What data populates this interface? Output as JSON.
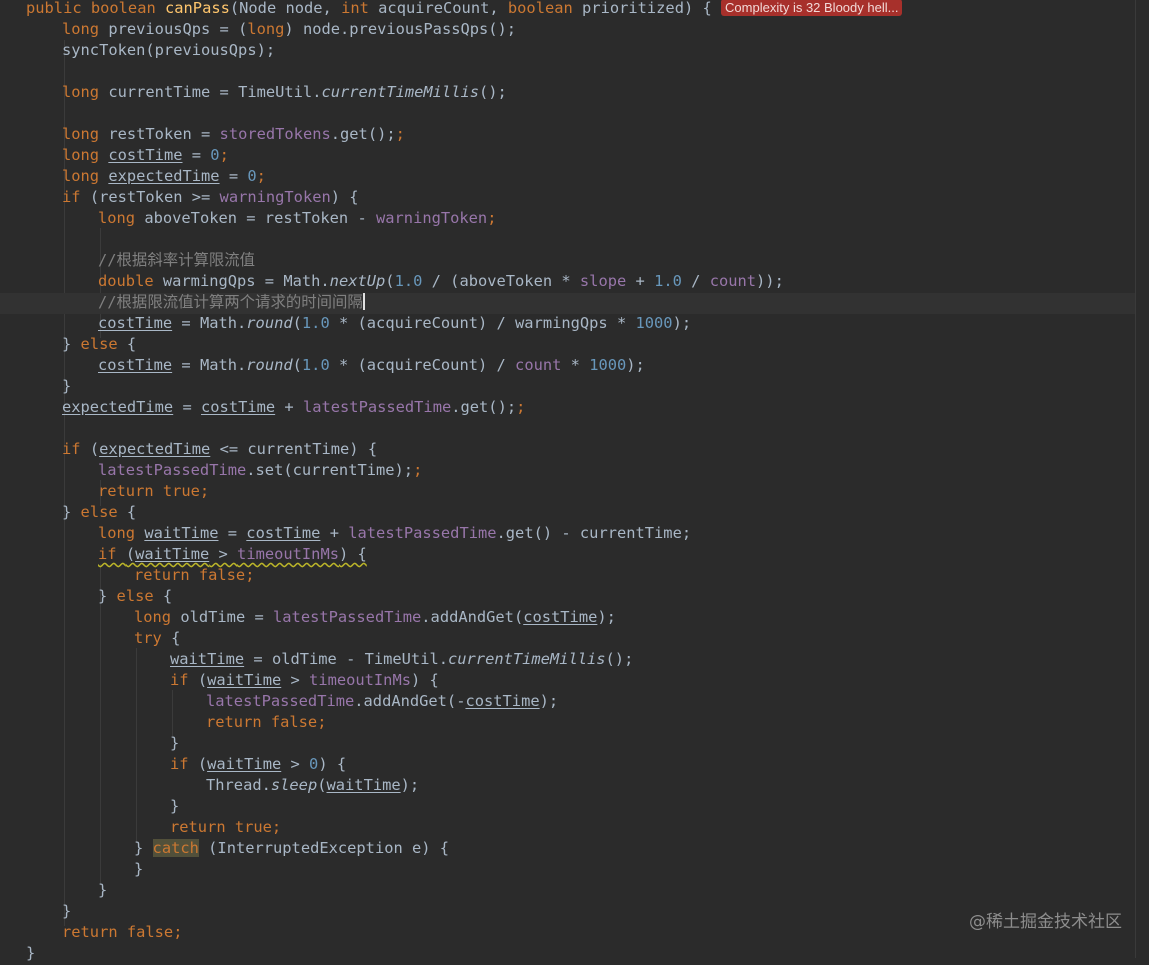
{
  "editor": {
    "complexity_hint": "Complexity is 32 Bloody hell...",
    "colors": {
      "background": "#2b2b2b",
      "keyword": "#cc7832",
      "method": "#ffc66d",
      "field": "#9876aa",
      "number": "#6897bb",
      "comment": "#808080",
      "text": "#a9b7c6",
      "badge": "#a7302b"
    },
    "code": {
      "l1": {
        "a": "public boolean ",
        "b": "canPass",
        "c": "(Node node, ",
        "d": "int ",
        "e": "acquireCount, ",
        "f": "boolean ",
        "g": "prioritized) { "
      },
      "l2": {
        "a": "long ",
        "b": "previousQps = (",
        "c": "long",
        "d": ") node.previousPassQps();"
      },
      "l3": {
        "a": "syncToken(previousQps);"
      },
      "l5": {
        "a": "long ",
        "b": "currentTime = TimeUtil.",
        "c": "currentTimeMillis",
        "d": "();"
      },
      "l7": {
        "a": "long ",
        "b": "restToken = ",
        "c": "storedTokens",
        "d": ".get();"
      },
      "l8": {
        "a": "long ",
        "b": "costTime",
        "c": " = ",
        "d": "0",
        ";": ";"
      },
      "l9": {
        "a": "long ",
        "b": "expectedTime",
        "c": " = ",
        "d": "0",
        ";": ";"
      },
      "l10": {
        "a": "if ",
        "b": "(restToken >= ",
        "c": "warningToken",
        "d": ") {"
      },
      "l11": {
        "a": "long ",
        "b": "aboveToken = restToken - ",
        "c": "warningToken",
        ";": ";"
      },
      "l13": {
        "a": "//根据斜率计算限流值"
      },
      "l14": {
        "a": "double ",
        "b": "warmingQps = Math.",
        "c": "nextUp",
        "d": "(",
        "n1": "1.0",
        "e": " / (aboveToken * ",
        "f": "slope",
        "g": " + ",
        "n2": "1.0",
        "h": " / ",
        "i": "count",
        "j": "));"
      },
      "l15": {
        "a": "//根据限流值计算两个请求的时间间隔"
      },
      "l16": {
        "a": "costTime",
        "b": " = Math.",
        "c": "round",
        "d": "(",
        "n1": "1.0",
        "e": " * (acquireCount) / warmingQps * ",
        "n2": "1000",
        "f": ");"
      },
      "l17": {
        "a": "} ",
        "b": "else ",
        "c": "{"
      },
      "l18": {
        "a": "costTime",
        "b": " = Math.",
        "c": "round",
        "d": "(",
        "n1": "1.0",
        "e": " * (acquireCount) / ",
        "f": "count",
        "g": " * ",
        "n2": "1000",
        "h": ");"
      },
      "l19": {
        "a": "}"
      },
      "l20": {
        "a": "expectedTime",
        "b": " = ",
        "c": "costTime",
        "d": " + ",
        "e": "latestPassedTime",
        "f": ".get();"
      },
      "l22": {
        "a": "if ",
        "b": "(",
        "c": "expectedTime",
        "d": " <= currentTime) {"
      },
      "l23": {
        "a": "latestPassedTime",
        "b": ".set(currentTime);"
      },
      "l24": {
        "a": "return true;"
      },
      "l25": {
        "a": "} ",
        "b": "else ",
        "c": "{"
      },
      "l26": {
        "a": "long ",
        "b": "waitTime",
        "c": " = ",
        "d": "costTime",
        "e": " + ",
        "f": "latestPassedTime",
        "g": ".get() - currentTime;"
      },
      "l27": {
        "a": "if ",
        "b": "(",
        "c": "waitTime",
        "d": " > ",
        "e": "timeoutInMs",
        "f": ") {"
      },
      "l28": {
        "a": "return false;"
      },
      "l29": {
        "a": "} ",
        "b": "else ",
        "c": "{"
      },
      "l30": {
        "a": "long ",
        "b": "oldTime = ",
        "c": "latestPassedTime",
        "d": ".addAndGet(",
        "e": "costTime",
        "f": ");"
      },
      "l31": {
        "a": "try ",
        "b": "{"
      },
      "l32": {
        "a": "waitTime",
        "b": " = oldTime - TimeUtil.",
        "c": "currentTimeMillis",
        "d": "();"
      },
      "l33": {
        "a": "if ",
        "b": "(",
        "c": "waitTime",
        "d": " > ",
        "e": "timeoutInMs",
        "f": ") {"
      },
      "l34": {
        "a": "latestPassedTime",
        "b": ".addAndGet(-",
        "c": "costTime",
        "d": ");"
      },
      "l35": {
        "a": "return false;"
      },
      "l36": {
        "a": "}"
      },
      "l37": {
        "a": "if ",
        "b": "(",
        "c": "waitTime",
        "d": " > ",
        "n1": "0",
        "e": ") {"
      },
      "l38": {
        "a": "Thread.",
        "b": "sleep",
        "c": "(",
        "d": "waitTime",
        "e": ");"
      },
      "l39": {
        "a": "}"
      },
      "l40": {
        "a": "return true;"
      },
      "l41": {
        "a": "} ",
        "b": "catch",
        "c": " (InterruptedException e) {"
      },
      "l42": {
        "a": "}"
      },
      "l43": {
        "a": "}"
      },
      "l44": {
        "a": "}"
      },
      "l45": {
        "a": "return false;"
      },
      "l46": {
        "a": "}"
      }
    }
  },
  "watermark": "@稀土掘金技术社区"
}
